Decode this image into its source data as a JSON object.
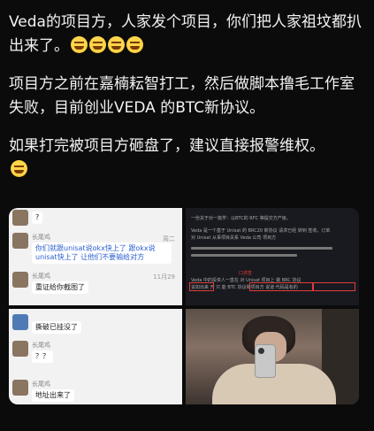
{
  "post": {
    "paragraphs": [
      "Veda的项目方，人家发个项目，你们把人家祖坟都扒出来了。",
      "项目方之前在嘉楠耘智打工，然后做脚本撸毛工作室失败，目前创业VEDA 的BTC新协议。",
      "如果打完被项目方砸盘了，建议直接报警维权。"
    ],
    "emoji_icon": "rofl-emoji-icon"
  },
  "images": {
    "chat1": {
      "top_text": "?",
      "sender": "长尾鸡",
      "time1": "周二",
      "message1": "你们就跟unisat说okx快上了 跟okx说unisat快上了 让他们不要输给对方",
      "sender2": "长尾鸡",
      "time2": "11月29",
      "message2": "重证给你截图了"
    },
    "doc": {
      "line1": "一份关于对一篇学：以BTC的 RFC 等提交方产级。",
      "line2": "Veda 是一个基于 Unisat 的 BRC20 新协议 请求已经 转到 签收，订单",
      "line3": "对 Unisat 从事项目关系 Veda 公司 项目方",
      "label": "口述签",
      "line4": "Veda 中的投资人一直在 对 Unisat 项目上 做 BRC 协议",
      "line5": "说如出来 开 只 能 BTC 协议和项目方 说道 代码是有的"
    },
    "chat2": {
      "message1": "撕破已挂没了",
      "sender": "长尾鸡",
      "message2": "？？",
      "sender2": "长尾鸡",
      "message3": "地址出来了"
    }
  },
  "colors": {
    "background": "#0b0b0b",
    "text": "#f2f2f2",
    "highlight": "#e23b3b"
  }
}
